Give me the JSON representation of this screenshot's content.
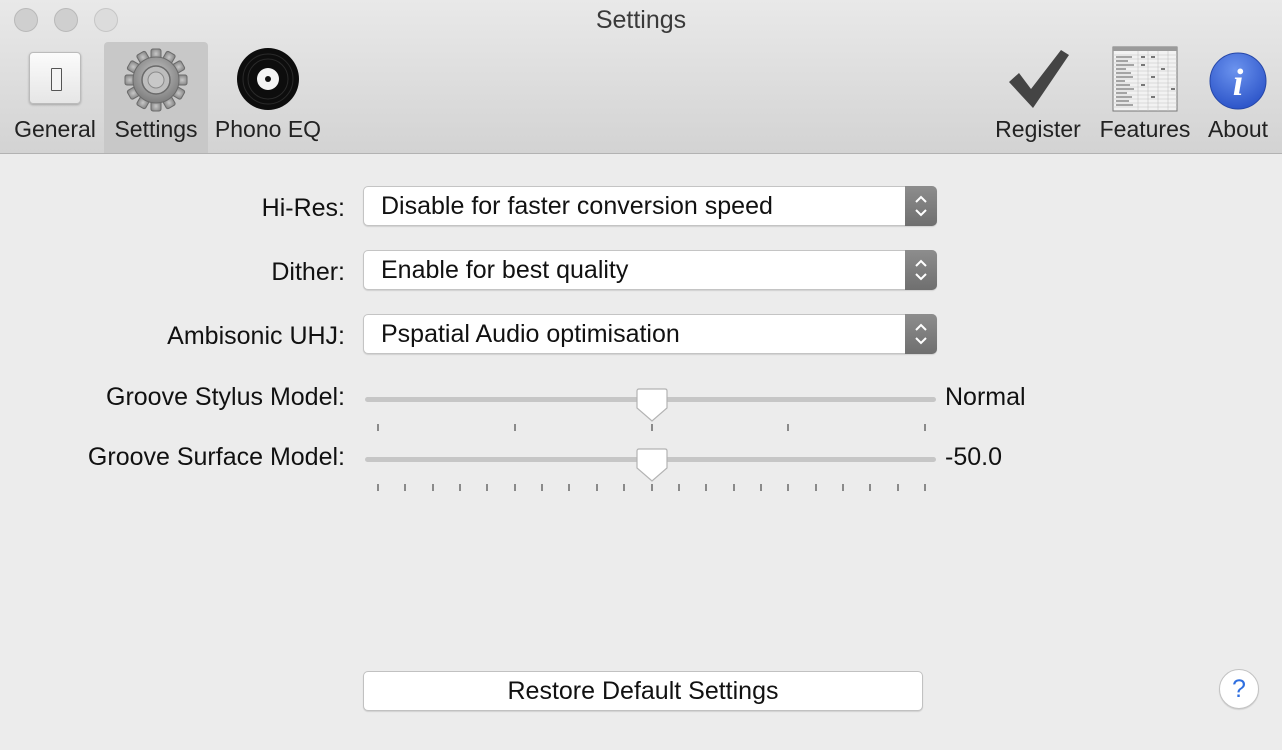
{
  "window": {
    "title": "Settings"
  },
  "toolbar": {
    "items": [
      {
        "label": "General",
        "icon": "toggle-switch-icon",
        "selected": false
      },
      {
        "label": "Settings",
        "icon": "gear-icon",
        "selected": true
      },
      {
        "label": "Phono EQ",
        "icon": "vinyl-record-icon",
        "selected": false
      },
      {
        "label": "Register",
        "icon": "checkmark-icon",
        "selected": false
      },
      {
        "label": "Features",
        "icon": "spreadsheet-icon",
        "selected": false
      },
      {
        "label": "About",
        "icon": "info-icon",
        "selected": false
      }
    ]
  },
  "form": {
    "hires": {
      "label": "Hi-Res:",
      "value": "Disable for faster conversion speed"
    },
    "dither": {
      "label": "Dither:",
      "value": "Enable for best quality"
    },
    "ambisonic": {
      "label": "Ambisonic UHJ:",
      "value": "Pspatial Audio optimisation"
    },
    "stylus": {
      "label": "Groove Stylus Model:",
      "value_text": "Normal",
      "position": 0.5,
      "tick_count": 5
    },
    "surface": {
      "label": "Groove Surface Model:",
      "value_text": "-50.0",
      "position": 0.5,
      "tick_count": 21
    }
  },
  "footer": {
    "restore_label": "Restore Default Settings",
    "help_label": "?"
  },
  "colors": {
    "about_icon": "#3f6fe0",
    "help": "#2f6fe0",
    "selected_tab": "#c8c8c8"
  }
}
